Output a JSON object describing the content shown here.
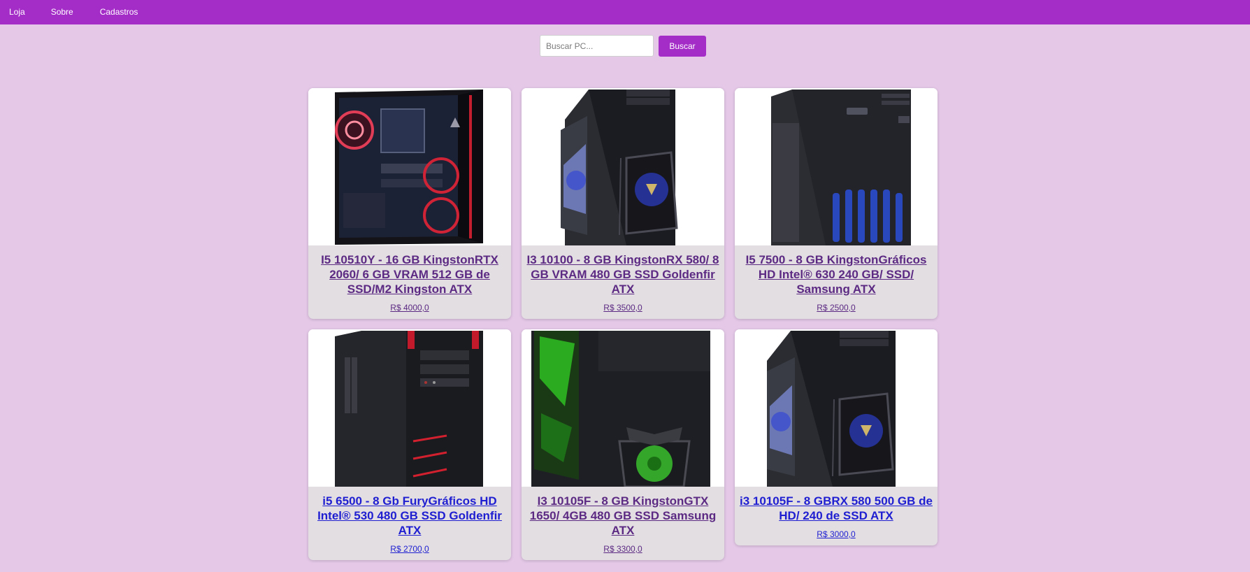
{
  "nav": {
    "items": [
      {
        "label": "Loja"
      },
      {
        "label": "Sobre"
      },
      {
        "label": "Cadastros"
      }
    ]
  },
  "search": {
    "placeholder": "Buscar PC...",
    "button_label": "Buscar"
  },
  "products": [
    {
      "title": "I5 10510Y - 16 GB KingstonRTX 2060/ 6 GB VRAM 512 GB de SSD/M2 Kingston ATX",
      "price": "R$ 4000,0",
      "link_state": "visited",
      "image": "pc-case-red-fans"
    },
    {
      "title": "I3 10100 - 8 GB KingstonRX 580/ 8 GB VRAM 480 GB SSD Goldenfir ATX",
      "price": "R$ 3500,0",
      "link_state": "visited",
      "image": "pc-case-blue-led"
    },
    {
      "title": "I5 7500 - 8 GB KingstonGráficos HD Intel® 630 240 GB/ SSD/ Samsung ATX",
      "price": "R$ 2500,0",
      "link_state": "visited",
      "image": "pc-case-black-blue-vents"
    },
    {
      "title": "i5 6500 - 8 Gb FuryGráficos HD Intel® 530 480 GB SSD Goldenfir ATX",
      "price": "R$ 2700,0",
      "link_state": "unvisited",
      "image": "pc-case-red-stripes"
    },
    {
      "title": "I3 10105F - 8 GB KingstonGTX 1650/ 4GB 480 GB SSD Samsung ATX",
      "price": "R$ 3300,0",
      "link_state": "visited",
      "image": "pc-case-green-led"
    },
    {
      "title": "i3 10105F - 8 GBRX 580 500 GB de HD/ 240 de SSD ATX",
      "price": "R$ 3000,0",
      "link_state": "unvisited",
      "image": "pc-case-blue-led"
    }
  ],
  "colors": {
    "navbar": "#a42dc8",
    "page_background": "#e5c8e8",
    "card_background": "#e2dee2",
    "visited_link": "#5c2a83",
    "unvisited_link": "#1f1fd1"
  }
}
